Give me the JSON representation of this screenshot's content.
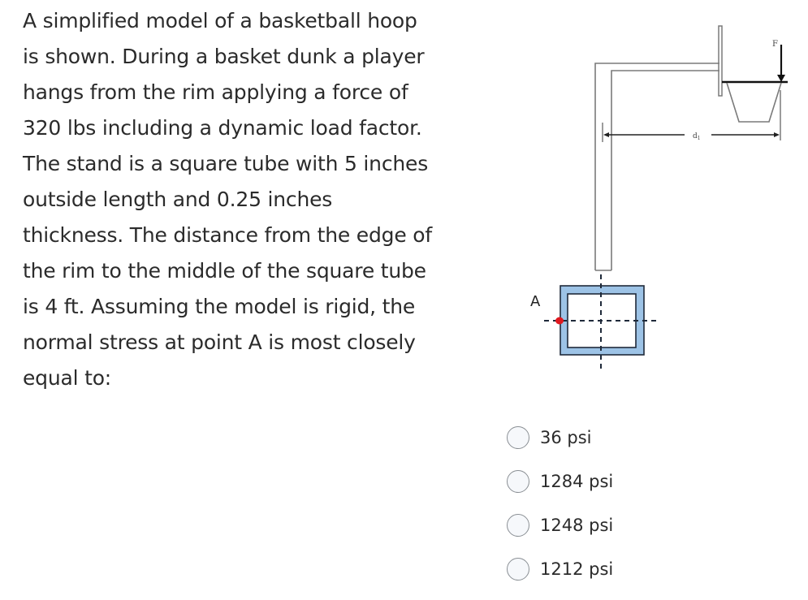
{
  "question": {
    "lines": [
      "A simplified model of a basketball hoop",
      "is shown. During a basket dunk a player",
      "hangs from the rim applying a force of",
      "320 lbs including a dynamic load factor.",
      "The stand is a square tube with 5 inches",
      "outside length and 0.25 inches",
      "thickness. The distance from the edge of",
      "the rim to the middle of the square tube",
      "is 4 ft.  Assuming the model is rigid, the",
      "normal stress at point A is most closely",
      "equal to:"
    ]
  },
  "diagram": {
    "force_label": "F",
    "distance_label": "d",
    "distance_subscript": "1",
    "point_label": "A",
    "colors": {
      "tube_fill": "#9dc3e6",
      "point_marker": "#e0191f",
      "line": "#7a7a7a",
      "outline": "#1f2a3a"
    }
  },
  "options": [
    {
      "label": "36 psi",
      "selected": false
    },
    {
      "label": "1284 psi",
      "selected": false
    },
    {
      "label": "1248 psi",
      "selected": false
    },
    {
      "label": "1212 psi",
      "selected": false
    }
  ]
}
